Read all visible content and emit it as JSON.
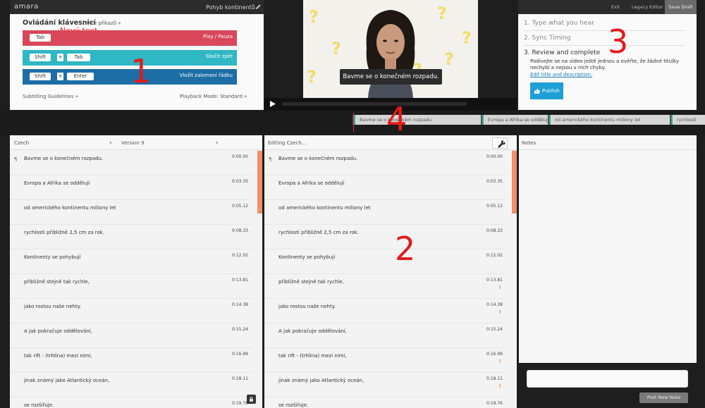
{
  "app": {
    "logo": "amara",
    "video_title": "Pohyb kontinentů"
  },
  "keyboard": {
    "title": "Ovládání klávesnicí",
    "more_link": "více příkazů »",
    "annotation_text": "Nový text...",
    "shortcuts": [
      {
        "keys": [
          "Tab"
        ],
        "label": "Play / Pauza",
        "color": "#d9475b"
      },
      {
        "keys": [
          "Shift",
          "+",
          "Tab"
        ],
        "label": "Skočit zpět",
        "color": "#2fb7c4"
      },
      {
        "keys": [
          "Shift",
          "+",
          "Enter"
        ],
        "label": "Vložit zalomení řádku",
        "color": "#1c6ea4"
      }
    ],
    "guidelines_link": "Subtitling Guidelines »",
    "playback_mode": "Playback Mode: Standard »"
  },
  "video": {
    "subtitle": "Bavme se o konečném rozpadu."
  },
  "workflow": {
    "exit": "Exit",
    "legacy": "Legacy Editor",
    "save_draft": "Save Draft",
    "steps": [
      "1. Type what you hear",
      "2. Sync Timing",
      "3. Review and complete"
    ],
    "review_text": "Podívejte se na video ještě jednou a ověřte, že žádné titulky nechybí a nejsou v nich chyby.",
    "edit_link": "Edit title and description.",
    "publish": "Publish"
  },
  "timeline": {
    "segments": [
      "Bavme se o konečném rozpadu.",
      "Evropa a Afrika se oddělují",
      "od amerického kontinentu miliony let",
      "rychlosti"
    ]
  },
  "reference": {
    "language": "Czech",
    "version": "Version 9"
  },
  "editing": {
    "header": "Editing Czech..."
  },
  "notes": {
    "header": "Notes",
    "post_button": "Post New Note"
  },
  "subtitles": [
    {
      "text": "Bavme se o konečném rozpadu.",
      "time": "0:00.00",
      "warn": false
    },
    {
      "text": "Evropa a Afrika se oddělují",
      "time": "0:03.35",
      "warn": false
    },
    {
      "text": "od amerického kontinentu miliony let",
      "time": "0:05.12",
      "warn": false
    },
    {
      "text": "rychlostí přibližně 2,5 cm za rok.",
      "time": "0:08.33",
      "warn": false
    },
    {
      "text": "Kontinenty se pohybují",
      "time": "0:12.02",
      "warn": false
    },
    {
      "text": "přibližně stejně tak rychle,",
      "time": "0:13.81",
      "warn": true
    },
    {
      "text": "jako rostou naše nehty.",
      "time": "0:14.38",
      "warn": true
    },
    {
      "text": "A jak pokračuje oddělování,",
      "time": "0:15.24",
      "warn": false
    },
    {
      "text": "tak rift - (trhlina) mezi nimi,",
      "time": "0:16.99",
      "warn": true
    },
    {
      "text": "jinak známý jako Atlantický oceán,",
      "time": "0:18.11",
      "warn": true
    },
    {
      "text": "se rozšiřuje.",
      "time": "0:19.76",
      "warn": false
    }
  ],
  "annotations": [
    "1",
    "2",
    "3",
    "4"
  ],
  "colors": {
    "accent": "#1e9fd6",
    "annotation": "#e21b1b",
    "sync_bar": "#f08f6a"
  }
}
